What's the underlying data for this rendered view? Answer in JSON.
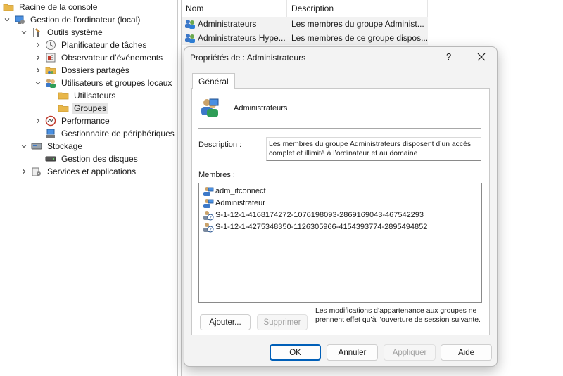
{
  "tree": {
    "items": [
      {
        "label": "Racine de la console",
        "indent": 0,
        "chevron": "none",
        "icon": "folder-icon",
        "selected": false
      },
      {
        "label": "Gestion de l'ordinateur (local)",
        "indent": 0,
        "chevron": "down",
        "icon": "computer-management-icon",
        "selected": false
      },
      {
        "label": "Outils système",
        "indent": 1,
        "chevron": "down",
        "icon": "tools-icon",
        "selected": false
      },
      {
        "label": "Planificateur de tâches",
        "indent": 2,
        "chevron": "right",
        "icon": "clock-icon",
        "selected": false
      },
      {
        "label": "Observateur d’événements",
        "indent": 2,
        "chevron": "right",
        "icon": "event-viewer-icon",
        "selected": false
      },
      {
        "label": "Dossiers partagés",
        "indent": 2,
        "chevron": "right",
        "icon": "shared-folder-icon",
        "selected": false
      },
      {
        "label": "Utilisateurs et groupes locaux",
        "indent": 2,
        "chevron": "down",
        "icon": "users-groups-icon",
        "selected": false
      },
      {
        "label": "Utilisateurs",
        "indent": 3,
        "chevron": "none",
        "icon": "folder-icon",
        "selected": false
      },
      {
        "label": "Groupes",
        "indent": 3,
        "chevron": "none",
        "icon": "folder-icon",
        "selected": true
      },
      {
        "label": "Performance",
        "indent": 2,
        "chevron": "right",
        "icon": "performance-icon",
        "selected": false
      },
      {
        "label": "Gestionnaire de périphériques",
        "indent": 2,
        "chevron": "none",
        "icon": "device-manager-icon",
        "selected": false
      },
      {
        "label": "Stockage",
        "indent": 1,
        "chevron": "down",
        "icon": "storage-icon",
        "selected": false
      },
      {
        "label": "Gestion des disques",
        "indent": 2,
        "chevron": "none",
        "icon": "disk-icon",
        "selected": false
      },
      {
        "label": "Services et applications",
        "indent": 1,
        "chevron": "right",
        "icon": "services-icon",
        "selected": false
      }
    ]
  },
  "list": {
    "columns": [
      "Nom",
      "Description"
    ],
    "rows": [
      {
        "name": "Administrateurs",
        "description": "Les membres du groupe Administ..."
      },
      {
        "name": "Administrateurs Hype...",
        "description": "Les membres de ce groupe dispos..."
      }
    ]
  },
  "dialog": {
    "title": "Propriétés de : Administrateurs",
    "help": "?",
    "tab": "Général",
    "group_name": "Administrateurs",
    "description_label": "Description :",
    "description_value": "Les membres du groupe Administrateurs disposent d’un accès complet et illimité à l’ordinateur et au domaine",
    "members_label": "Membres :",
    "members": [
      {
        "name": "adm_itconnect",
        "icon": "user-icon"
      },
      {
        "name": "Administrateur",
        "icon": "user-icon"
      },
      {
        "name": "S-1-12-1-4168174272-1076198093-2869169043-467542293",
        "icon": "unknown-user-icon"
      },
      {
        "name": "S-1-12-1-4275348350-1126305966-4154393774-2895494852",
        "icon": "unknown-user-icon"
      }
    ],
    "add_button": "Ajouter...",
    "remove_button": "Supprimer",
    "note": "Les modifications d’appartenance aux groupes ne prennent effet qu’à l’ouverture de session suivante.",
    "ok_button": "OK",
    "cancel_button": "Annuler",
    "apply_button": "Appliquer",
    "help_button": "Aide"
  },
  "colors": {
    "accent": "#005fb8",
    "folder": "#e8b74a",
    "selection": "#e5e5e5"
  }
}
